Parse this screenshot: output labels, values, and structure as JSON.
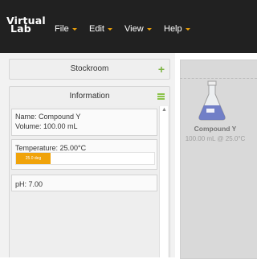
{
  "app": {
    "logo_line1": "Virtual",
    "logo_line2": "Lab"
  },
  "menu": [
    {
      "label": "File"
    },
    {
      "label": "Edit"
    },
    {
      "label": "View"
    },
    {
      "label": "Help"
    }
  ],
  "stockroom": {
    "title": "Stockroom",
    "icon": "plus-icon"
  },
  "information": {
    "title": "Information",
    "icon": "hamburger-menu-icon",
    "name_line": "Name: Compound Y",
    "volume_line": "Volume: 100.00 mL",
    "temperature_line": "Temperature: 25.00°C",
    "temperature_bar_label": "25.0 deg",
    "temperature_bar_fraction": 0.25,
    "ph_line": "pH: 7.00"
  },
  "workbench": {
    "item_name": "Compound Y",
    "item_detail": "100.00 mL @ 25.0°C",
    "item_icon": "erlenmeyer-flask-icon"
  },
  "colors": {
    "accent": "#f0a30a",
    "plus": "#7cb342",
    "navbar": "#212121"
  }
}
